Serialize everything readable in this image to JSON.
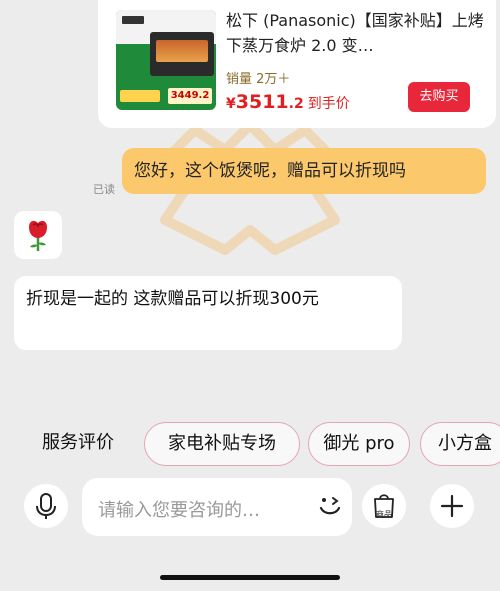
{
  "product": {
    "title": "松下 (Panasonic)【国家补贴】上烤下蒸万食炉 2.0 变…",
    "sales": "销量 2万＋",
    "price_symbol": "¥",
    "price_int": "3511",
    "price_dec": ".2",
    "price_suffix": "到手价",
    "buy_label": "去购买",
    "thumb_price": "3449.2"
  },
  "outgoing": {
    "read_status": "已读",
    "text": "您好，这个饭煲呢，赠品可以折现吗"
  },
  "incoming": {
    "emoji": "🌹",
    "text": "折现是一起的   这款赠品可以折现300元"
  },
  "quick_replies": [
    "服务评价",
    "家电补贴专场",
    "御光 pro",
    "小方盒"
  ],
  "input": {
    "placeholder": "请输入您要咨询的…",
    "goods_label": "商品"
  },
  "icons": {
    "mic": "microphone-icon",
    "emoji": "emoji-face-icon",
    "goods": "shopping-bag-icon",
    "add": "plus-icon"
  },
  "colors": {
    "outgoing_bubble": "#fbc96b",
    "buy_button": "#e8283a",
    "price": "#e02020"
  }
}
